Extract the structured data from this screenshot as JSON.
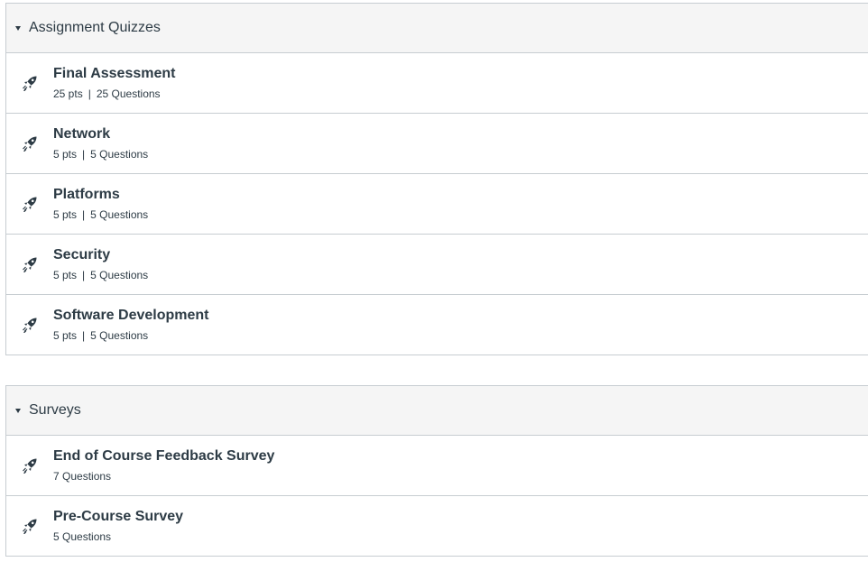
{
  "sections": [
    {
      "title": "Assignment Quizzes",
      "items": [
        {
          "title": "Final Assessment",
          "points": "25 pts",
          "questions": "25 Questions"
        },
        {
          "title": "Network",
          "points": "5 pts",
          "questions": "5 Questions"
        },
        {
          "title": "Platforms",
          "points": "5 pts",
          "questions": "5 Questions"
        },
        {
          "title": "Security",
          "points": "5 pts",
          "questions": "5 Questions"
        },
        {
          "title": "Software Development",
          "points": "5 pts",
          "questions": "5 Questions"
        }
      ]
    },
    {
      "title": "Surveys",
      "items": [
        {
          "title": "End of Course Feedback Survey",
          "questions": "7 Questions"
        },
        {
          "title": "Pre-Course Survey",
          "questions": "5 Questions"
        }
      ]
    }
  ],
  "separator": "|",
  "icons": {
    "collapse": "caret-down-icon",
    "item": "rocket-quiz-icon"
  },
  "colors": {
    "header_bg": "#f5f5f5",
    "border": "#c7cdd1",
    "text": "#2d3b45"
  }
}
